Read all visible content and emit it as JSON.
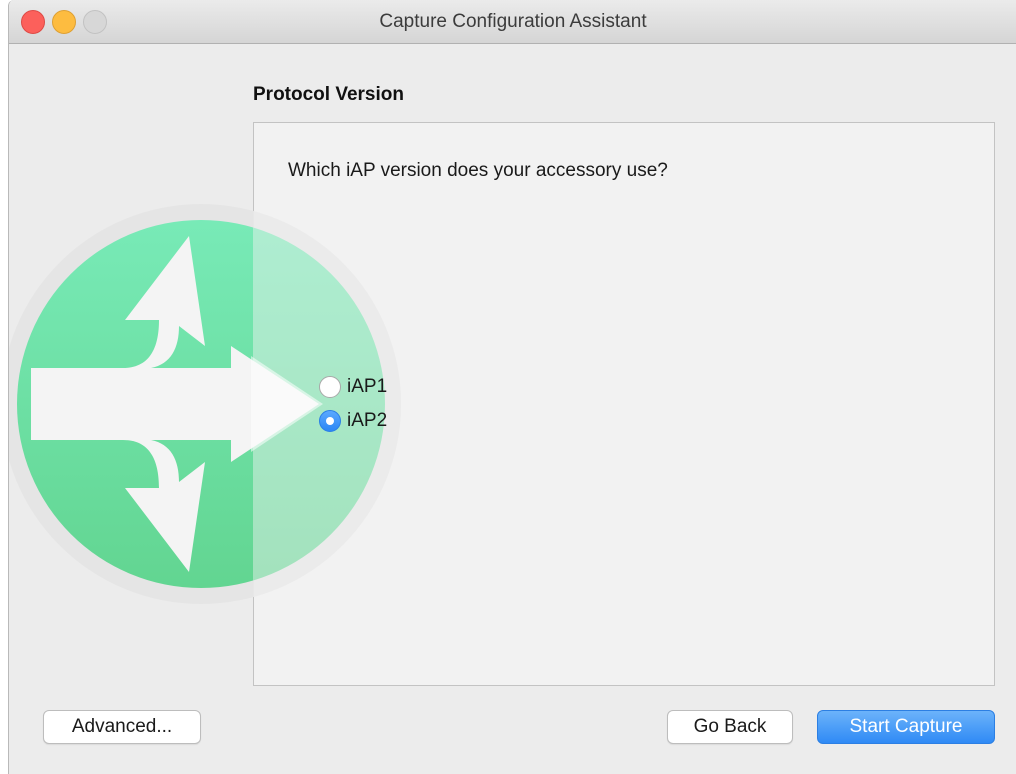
{
  "window": {
    "title": "Capture Configuration Assistant"
  },
  "page": {
    "section_title": "Protocol Version",
    "question": "Which iAP version does your accessory use?"
  },
  "options": [
    {
      "label": "iAP1",
      "selected": false
    },
    {
      "label": "iAP2",
      "selected": true
    }
  ],
  "footer": {
    "advanced_label": "Advanced...",
    "back_label": "Go Back",
    "start_label": "Start Capture"
  },
  "colors": {
    "accent": "#2f8af5",
    "logo_green": "#6ee3a7",
    "close": "#fc605b",
    "minimize": "#fdbc40",
    "zoom_disabled": "#d7d7d7"
  },
  "icons": {
    "logo": "branching-arrows-icon"
  }
}
